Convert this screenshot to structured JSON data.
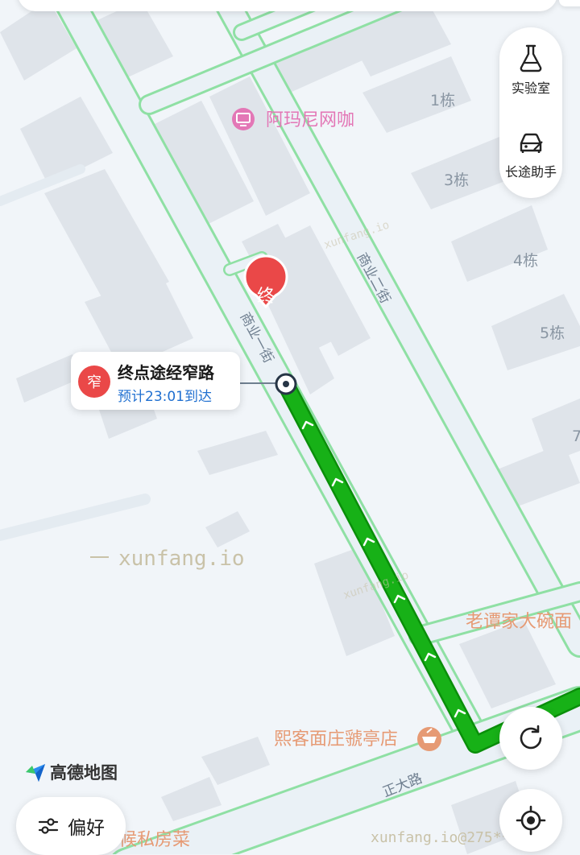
{
  "map": {
    "roads": [
      {
        "id": "shangye-1",
        "label": "商业一街"
      },
      {
        "id": "shangye-2",
        "label": "商业二街"
      },
      {
        "id": "zhengda",
        "label": "正大路"
      }
    ],
    "buildings": [
      "1栋",
      "3栋",
      "4栋",
      "5栋",
      "7"
    ],
    "pois": [
      {
        "id": "amani",
        "label": "阿玛尼网咖",
        "color": "#e377b6"
      },
      {
        "id": "laotan",
        "label": "老谭家大碗面",
        "color": "#e69a74"
      },
      {
        "id": "xike",
        "label": "熙客面庄虢亭店",
        "color": "#e69a74"
      },
      {
        "id": "sifang",
        "label": "候私房菜",
        "color": "#e69a74"
      }
    ],
    "destination_marker": "终",
    "watermarks": {
      "main": "xunfang.io",
      "faint1": "xunfang.io",
      "faint2": "xunfang.io",
      "corner": "xunfang.io@275**171"
    },
    "route_color": "#17b117",
    "road_border_color": "#8fe0a4"
  },
  "side_panel": {
    "lab_label": "实验室",
    "assistant_label": "长途助手"
  },
  "callout": {
    "badge": "窄",
    "title": "终点途经窄路",
    "subtitle": "预计23:01到达"
  },
  "logo": {
    "label": "高德地图"
  },
  "preference": {
    "label": "偏好"
  },
  "icons": {
    "lab": "flask-icon",
    "assistant": "car-icon",
    "refresh": "refresh-icon",
    "locate": "locate-icon",
    "preference": "sliders-icon",
    "logo": "amap-logo-icon"
  }
}
